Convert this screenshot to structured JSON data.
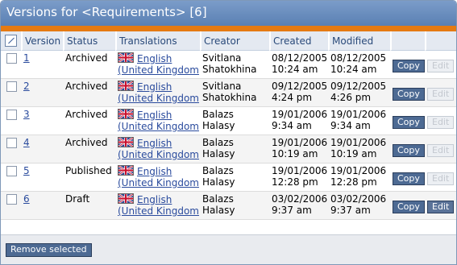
{
  "title": "Versions for <Requirements> [6]",
  "columns": {
    "version": "Version",
    "status": "Status",
    "translations": "Translations",
    "creator": "Creator",
    "created": "Created",
    "modified": "Modified"
  },
  "copy_label": "Copy",
  "edit_label": "Edit",
  "remove_selected_label": "Remove selected",
  "rows": [
    {
      "version": "1",
      "status": "Archived",
      "lang1": "English",
      "lang2": "(United Kingdom)",
      "creator1": "Svitlana",
      "creator2": "Shatokhina",
      "created_date": "08/12/2005",
      "created_time": "10:24 am",
      "modified_date": "08/12/2005",
      "modified_time": "10:24 am",
      "edit_enabled": false
    },
    {
      "version": "2",
      "status": "Archived",
      "lang1": "English",
      "lang2": "(United Kingdom)",
      "creator1": "Svitlana",
      "creator2": "Shatokhina",
      "created_date": "09/12/2005",
      "created_time": "4:24 pm",
      "modified_date": "09/12/2005",
      "modified_time": "4:26 pm",
      "edit_enabled": false
    },
    {
      "version": "3",
      "status": "Archived",
      "lang1": "English",
      "lang2": "(United Kingdom)",
      "creator1": "Balazs",
      "creator2": "Halasy",
      "created_date": "19/01/2006",
      "created_time": "9:34 am",
      "modified_date": "19/01/2006",
      "modified_time": "9:34 am",
      "edit_enabled": false
    },
    {
      "version": "4",
      "status": "Archived",
      "lang1": "English",
      "lang2": "(United Kingdom)",
      "creator1": "Balazs",
      "creator2": "Halasy",
      "created_date": "19/01/2006",
      "created_time": "10:19 am",
      "modified_date": "19/01/2006",
      "modified_time": "10:19 am",
      "edit_enabled": false
    },
    {
      "version": "5",
      "status": "Published",
      "lang1": "English",
      "lang2": "(United Kingdom)",
      "creator1": "Balazs",
      "creator2": "Halasy",
      "created_date": "19/01/2006",
      "created_time": "12:28 pm",
      "modified_date": "19/01/2006",
      "modified_time": "12:28 pm",
      "edit_enabled": false
    },
    {
      "version": "6",
      "status": "Draft",
      "lang1": "English",
      "lang2": "(United Kingdom)",
      "creator1": "Balazs",
      "creator2": "Halasy",
      "created_date": "03/02/2006",
      "created_time": "9:37 am",
      "modified_date": "03/02/2006",
      "modified_time": "9:37 am",
      "edit_enabled": true
    }
  ],
  "colors": {
    "title_bar": "#5a80b3",
    "accent_bar": "#e57a12",
    "header_bg": "#e4e9f1",
    "header_text": "#2a4a7a",
    "button_bg": "#4d6a93",
    "link": "#2a4b9d"
  },
  "icons": {
    "select_all": "select-all-checkbox-icon",
    "flag": "uk-flag-icon"
  }
}
